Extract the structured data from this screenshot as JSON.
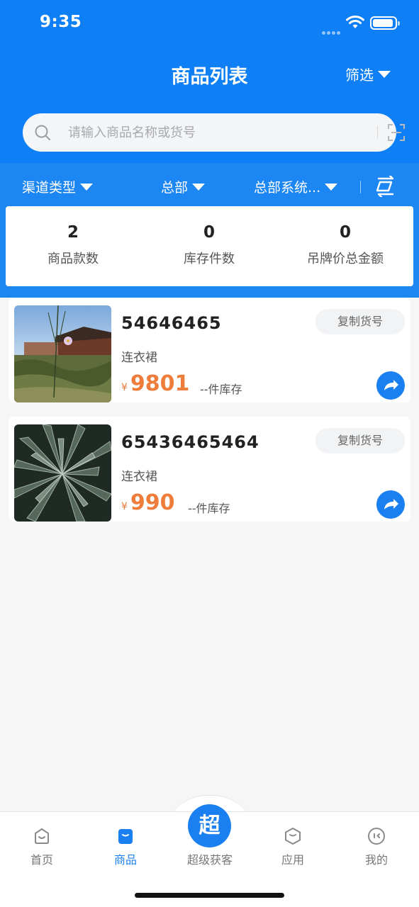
{
  "status_bar": {
    "time": "9:35"
  },
  "header": {
    "title": "商品列表",
    "filter_label": "筛选"
  },
  "search": {
    "placeholder": "请输入商品名称或货号"
  },
  "filter_bar": {
    "channel_type": "渠道类型",
    "headquarters": "总部",
    "hq_system": "总部系统..."
  },
  "stats": [
    {
      "value": "2",
      "label": "商品款数"
    },
    {
      "value": "0",
      "label": "库存件数"
    },
    {
      "value": "0",
      "label": "吊牌价总金额"
    }
  ],
  "products": [
    {
      "code": "54646465",
      "copy_label": "复制货号",
      "category": "连衣裙",
      "currency": "¥",
      "price": "9801",
      "stock": "--件库存",
      "image": "garden-flower-photo"
    },
    {
      "code": "65436465464",
      "copy_label": "复制货号",
      "category": "连衣裙",
      "currency": "¥",
      "price": "990",
      "stock": "--件库存",
      "image": "succulent-leaves-photo"
    }
  ],
  "tabbar": {
    "home": "首页",
    "products": "商品",
    "center_glyph": "超",
    "center": "超级获客",
    "apps": "应用",
    "mine": "我的"
  },
  "colors": {
    "primary": "#0f7ff5",
    "price": "#ee7c3b",
    "active_tab": "#1a7ff0"
  }
}
